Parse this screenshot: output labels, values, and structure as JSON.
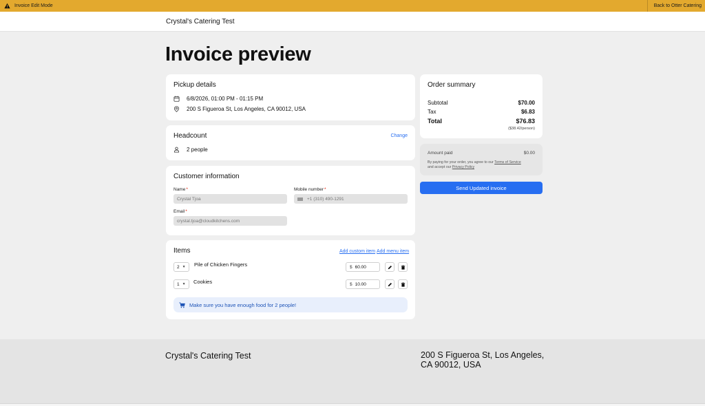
{
  "banner": {
    "title": "Invoice Edit Mode",
    "back_label": "Back to Otter Catering"
  },
  "topbar": {
    "brand": "Crystal's Catering Test"
  },
  "page_title": "Invoice preview",
  "pickup": {
    "title": "Pickup details",
    "datetime": "6/8/2026, 01:00 PM - 01:15 PM",
    "address": "200 S Figueroa St, Los Angeles, CA 90012, USA"
  },
  "headcount": {
    "title": "Headcount",
    "change_label": "Change",
    "value": "2 people"
  },
  "customer": {
    "title": "Customer information",
    "name_label": "Name",
    "name_placeholder": "Crystal Tjoa",
    "mobile_label": "Mobile number",
    "mobile_placeholder": "+1 (310) 490-1291",
    "email_label": "Email",
    "email_placeholder": "crystal.tjoa@cloudkitchens.com",
    "required_mark": "*"
  },
  "items": {
    "title": "Items",
    "add_custom_label": "Add custom item",
    "add_menu_label": "Add menu item",
    "currency": "$",
    "list": [
      {
        "qty": "2",
        "name": "Pile of Chicken Fingers",
        "price": "60.00"
      },
      {
        "qty": "1",
        "name": "Cookies",
        "price": "10.00"
      }
    ],
    "notice": "Make sure you have enough food for 2 people!"
  },
  "summary": {
    "title": "Order summary",
    "subtotal_label": "Subtotal",
    "subtotal": "$70.00",
    "tax_label": "Tax",
    "tax": "$6.83",
    "total_label": "Total",
    "total": "$76.83",
    "per_person": "($38.42/person)"
  },
  "payment": {
    "paid_label": "Amount paid",
    "paid": "$0.00",
    "terms_prefix": "By paying for your order, you agree to our",
    "terms_link": "Terms of Service",
    "terms_mid": "and accept our",
    "privacy_link": "Privacy Policy",
    "send_label": "Send Updated invoice"
  },
  "footer": {
    "brand": "Crystal's Catering Test",
    "address": "200 S Figueroa St, Los Angeles, CA 90012, USA"
  },
  "colors": {
    "banner": "#e3a92e",
    "accent": "#276ef1",
    "notice_bg": "#e8effc",
    "required": "#e11900"
  },
  "icons": [
    "warning-icon",
    "calendar-icon",
    "location-pin-icon",
    "person-icon",
    "flag-icon",
    "chevron-down-icon",
    "pencil-icon",
    "trash-icon",
    "cart-icon"
  ]
}
